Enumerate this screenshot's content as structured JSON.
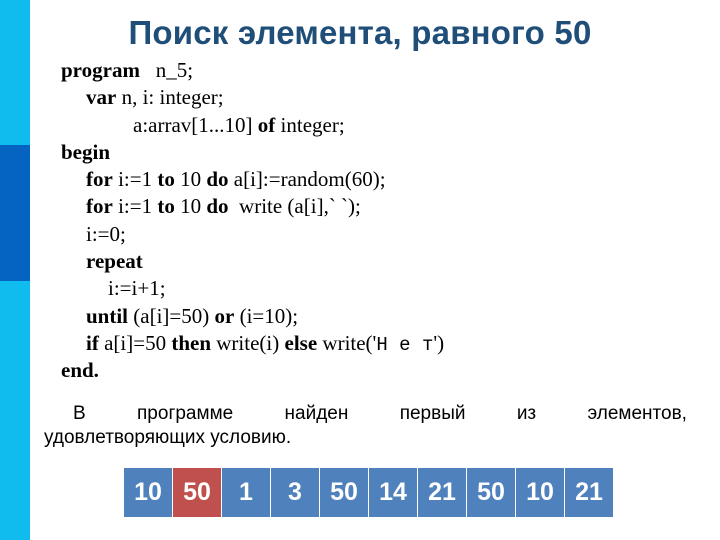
{
  "slide": {
    "title": "Поиск элемента, равного 50",
    "accent_colors": {
      "bar": "#10bbed",
      "bar_dark": "#0563c1",
      "title": "#1f4e79"
    }
  },
  "code": {
    "lines": [
      {
        "indent": 0,
        "parts": [
          {
            "t": "program",
            "kw": true
          },
          {
            "t": "   n_5;"
          }
        ]
      },
      {
        "indent": 1,
        "parts": [
          {
            "t": "var",
            "kw": true
          },
          {
            "t": " n, i: integer;"
          }
        ]
      },
      {
        "indent": 3,
        "parts": [
          {
            "t": "a:arrav[1...10] "
          },
          {
            "t": "of",
            "kw": true
          },
          {
            "t": " integer;"
          }
        ]
      },
      {
        "indent": 0,
        "parts": [
          {
            "t": "begin",
            "kw": true
          }
        ]
      },
      {
        "indent": 1,
        "parts": [
          {
            "t": "for",
            "kw": true
          },
          {
            "t": " i:=1 "
          },
          {
            "t": "to",
            "kw": true
          },
          {
            "t": " 10 "
          },
          {
            "t": "do",
            "kw": true
          },
          {
            "t": " a[i]:=random(60);"
          }
        ]
      },
      {
        "indent": 1,
        "parts": [
          {
            "t": "for",
            "kw": true
          },
          {
            "t": " i:=1 "
          },
          {
            "t": "to",
            "kw": true
          },
          {
            "t": " 10 "
          },
          {
            "t": "do",
            "kw": true
          },
          {
            "t": "  write (a[i],` `);"
          }
        ]
      },
      {
        "indent": 1,
        "parts": [
          {
            "t": "i:=0;"
          }
        ]
      },
      {
        "indent": 1,
        "parts": [
          {
            "t": "repeat",
            "kw": true
          }
        ]
      },
      {
        "indent": 2,
        "parts": [
          {
            "t": "i:=i+1;"
          }
        ]
      },
      {
        "indent": 1,
        "parts": [
          {
            "t": "until",
            "kw": true
          },
          {
            "t": " (a[i]=50) "
          },
          {
            "t": "or",
            "kw": true
          },
          {
            "t": " (i=10);"
          }
        ]
      },
      {
        "indent": 1,
        "parts": [
          {
            "t": "if",
            "kw": true
          },
          {
            "t": " a[i]=50 "
          },
          {
            "t": "then",
            "kw": true
          },
          {
            "t": " write(i) "
          },
          {
            "t": "else",
            "kw": true
          },
          {
            "t": " write('"
          },
          {
            "t": "Н е т",
            "mono": true
          },
          {
            "t": "')"
          }
        ]
      },
      {
        "indent": 0,
        "parts": [
          {
            "t": "end.",
            "kw": true
          }
        ]
      }
    ]
  },
  "description": {
    "line1_words": [
      "В",
      "программе",
      "найден",
      "первый",
      "из",
      "элементов,"
    ],
    "line2": "удовлетворяющих условию."
  },
  "array": {
    "values": [
      10,
      50,
      1,
      3,
      50,
      14,
      21,
      50,
      10,
      21
    ],
    "highlight_index": 1,
    "cell_color": "#4f81bd",
    "highlight_color": "#c0504d"
  }
}
